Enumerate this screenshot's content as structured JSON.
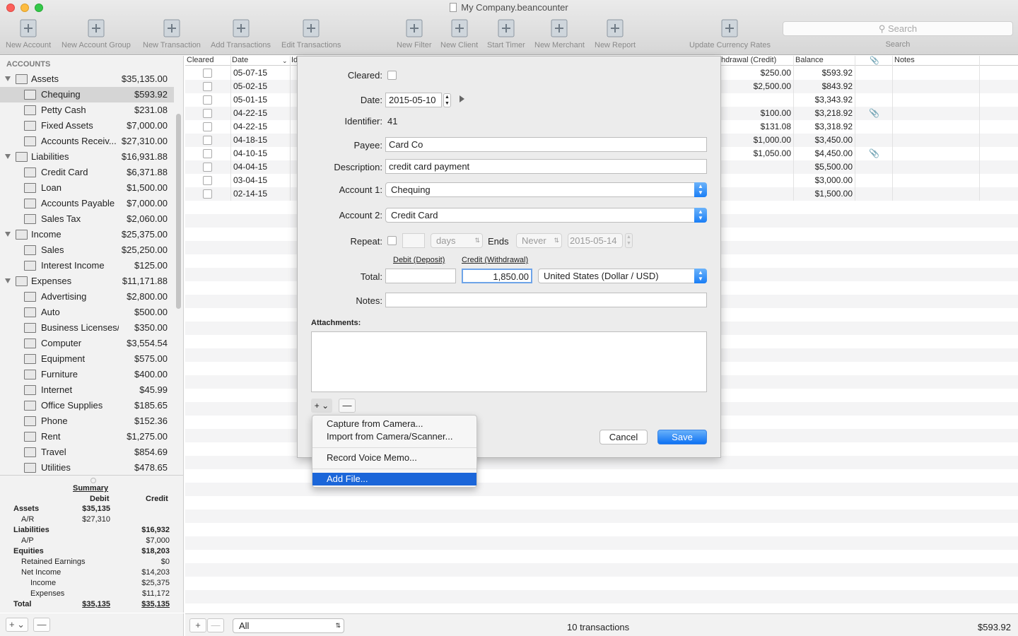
{
  "window": {
    "title": "My Company.beancounter"
  },
  "toolbar": {
    "items": [
      {
        "label": "New Account",
        "icon": "new-account-icon"
      },
      {
        "label": "New Account Group",
        "icon": "new-account-group-icon"
      },
      {
        "label": "New Transaction",
        "icon": "new-transaction-icon"
      },
      {
        "label": "Add Transactions",
        "icon": "add-transactions-icon"
      },
      {
        "label": "Edit Transactions",
        "icon": "edit-transactions-icon"
      },
      {
        "label": "New Filter",
        "icon": "filter-icon"
      },
      {
        "label": "New Client",
        "icon": "client-icon"
      },
      {
        "label": "Start Timer",
        "icon": "timer-icon"
      },
      {
        "label": "New Merchant",
        "icon": "merchant-icon"
      },
      {
        "label": "New Report",
        "icon": "report-icon"
      },
      {
        "label": "Update Currency Rates",
        "icon": "currency-globe-icon"
      }
    ],
    "search_placeholder": "Search",
    "search_label": "Search"
  },
  "sidebar": {
    "header": "ACCOUNTS",
    "accounts": [
      {
        "name": "Assets",
        "amount": "$35,135.00",
        "group": true
      },
      {
        "name": "Chequing",
        "amount": "$593.92",
        "selected": true
      },
      {
        "name": "Petty Cash",
        "amount": "$231.08"
      },
      {
        "name": "Fixed Assets",
        "amount": "$7,000.00"
      },
      {
        "name": "Accounts Receiv...",
        "amount": "$27,310.00"
      },
      {
        "name": "Liabilities",
        "amount": "$16,931.88",
        "group": true
      },
      {
        "name": "Credit Card",
        "amount": "$6,371.88"
      },
      {
        "name": "Loan",
        "amount": "$1,500.00"
      },
      {
        "name": "Accounts Payable",
        "amount": "$7,000.00"
      },
      {
        "name": "Sales Tax",
        "amount": "$2,060.00"
      },
      {
        "name": "Income",
        "amount": "$25,375.00",
        "group": true
      },
      {
        "name": "Sales",
        "amount": "$25,250.00"
      },
      {
        "name": "Interest Income",
        "amount": "$125.00"
      },
      {
        "name": "Expenses",
        "amount": "$11,171.88",
        "group": true
      },
      {
        "name": "Advertising",
        "amount": "$2,800.00"
      },
      {
        "name": "Auto",
        "amount": "$500.00"
      },
      {
        "name": "Business Licenses/...",
        "amount": "$350.00"
      },
      {
        "name": "Computer",
        "amount": "$3,554.54"
      },
      {
        "name": "Equipment",
        "amount": "$575.00"
      },
      {
        "name": "Furniture",
        "amount": "$400.00"
      },
      {
        "name": "Internet",
        "amount": "$45.99"
      },
      {
        "name": "Office Supplies",
        "amount": "$185.65"
      },
      {
        "name": "Phone",
        "amount": "$152.36"
      },
      {
        "name": "Rent",
        "amount": "$1,275.00"
      },
      {
        "name": "Travel",
        "amount": "$854.69"
      },
      {
        "name": "Utilities",
        "amount": "$478.65"
      }
    ]
  },
  "summary": {
    "title": "Summary",
    "debit_header": "Debit",
    "credit_header": "Credit",
    "rows": [
      {
        "label": "Assets",
        "debit": "$35,135",
        "credit": "",
        "bold": true,
        "indent": 0
      },
      {
        "label": "A/R",
        "debit": "$27,310",
        "credit": "",
        "bold": false,
        "indent": 1
      },
      {
        "label": "Liabilities",
        "debit": "",
        "credit": "$16,932",
        "bold": true,
        "indent": 0
      },
      {
        "label": "A/P",
        "debit": "",
        "credit": "$7,000",
        "bold": false,
        "indent": 1
      },
      {
        "label": "Equities",
        "debit": "",
        "credit": "$18,203",
        "bold": true,
        "indent": 0
      },
      {
        "label": "Retained Earnings",
        "debit": "",
        "credit": "$0",
        "bold": false,
        "indent": 1
      },
      {
        "label": "Net Income",
        "debit": "",
        "credit": "$14,203",
        "bold": false,
        "indent": 1
      },
      {
        "label": "Income",
        "debit": "",
        "credit": "$25,375",
        "bold": false,
        "indent": 2
      },
      {
        "label": "Expenses",
        "debit": "",
        "credit": "$11,172",
        "bold": false,
        "indent": 2
      },
      {
        "label": "Total",
        "debit": "$35,135",
        "credit": "$35,135",
        "bold": true,
        "indent": 0
      }
    ]
  },
  "table": {
    "columns": {
      "cleared": "Cleared",
      "date": "Date",
      "id": "Id",
      "withdrawal": "hdrawal (Credit)",
      "balance": "Balance",
      "notes": "Notes"
    },
    "rows": [
      {
        "date": "05-07-15",
        "withdrawal": "$250.00",
        "balance": "$593.92",
        "attach": false
      },
      {
        "date": "05-02-15",
        "withdrawal": "$2,500.00",
        "balance": "$843.92",
        "attach": false
      },
      {
        "date": "05-01-15",
        "withdrawal": "",
        "balance": "$3,343.92",
        "attach": false
      },
      {
        "date": "04-22-15",
        "withdrawal": "$100.00",
        "balance": "$3,218.92",
        "attach": true
      },
      {
        "date": "04-22-15",
        "withdrawal": "$131.08",
        "balance": "$3,318.92",
        "attach": false
      },
      {
        "date": "04-18-15",
        "withdrawal": "$1,000.00",
        "balance": "$3,450.00",
        "attach": false
      },
      {
        "date": "04-10-15",
        "withdrawal": "$1,050.00",
        "balance": "$4,450.00",
        "attach": true
      },
      {
        "date": "04-04-15",
        "withdrawal": "",
        "balance": "$5,500.00",
        "attach": false
      },
      {
        "date": "03-04-15",
        "withdrawal": "",
        "balance": "$3,000.00",
        "attach": false
      },
      {
        "date": "02-14-15",
        "withdrawal": "",
        "balance": "$1,500.00",
        "attach": false
      }
    ]
  },
  "footer": {
    "filter_value": "All",
    "count_text": "10 transactions",
    "balance": "$593.92"
  },
  "dialog": {
    "cleared_label": "Cleared:",
    "date_label": "Date:",
    "date_value": "2015-05-10",
    "identifier_label": "Identifier:",
    "identifier_value": "41",
    "payee_label": "Payee:",
    "payee_value": "Card Co",
    "description_label": "Description:",
    "description_value": "credit card payment",
    "account1_label": "Account 1:",
    "account1_value": "Chequing",
    "account2_label": "Account 2:",
    "account2_value": "Credit Card",
    "repeat_label": "Repeat:",
    "repeat_unit": "days",
    "ends_label": "Ends",
    "ends_value": "Never",
    "ends_date": "2015-05-14",
    "debit_header": "Debit (Deposit)",
    "credit_header": "Credit (Withdrawal)",
    "total_label": "Total:",
    "debit_value": "",
    "credit_value": "1,850.00",
    "currency": "United States (Dollar / USD)",
    "notes_label": "Notes:",
    "notes_value": "",
    "attachments_label": "Attachments:",
    "cancel": "Cancel",
    "save": "Save"
  },
  "menu": {
    "items": [
      "Capture from Camera...",
      "Import from Camera/Scanner...",
      "Record Voice Memo...",
      "Add File..."
    ]
  }
}
